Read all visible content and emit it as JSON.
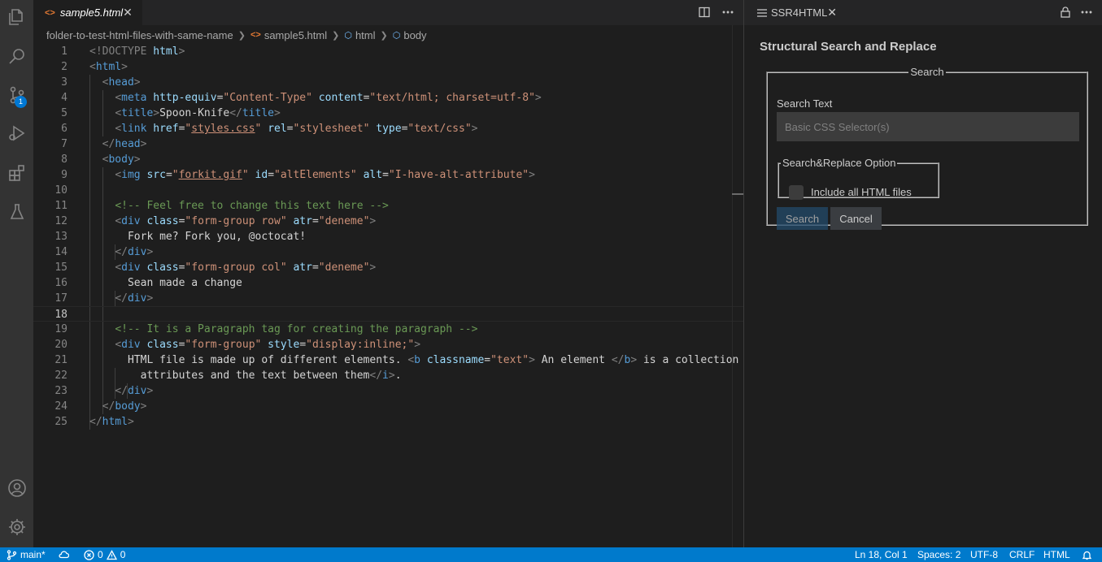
{
  "editor": {
    "tab": {
      "icon": "html-file-icon",
      "label": "sample5.html",
      "close": "✕"
    },
    "breadcrumb": {
      "folder": "folder-to-test-html-files-with-same-name",
      "file": "sample5.html",
      "element1": "html",
      "element2": "body"
    },
    "current_line": 18,
    "lines": [
      {
        "n": "1"
      },
      {
        "n": "2"
      },
      {
        "n": "3"
      },
      {
        "n": "4"
      },
      {
        "n": "5"
      },
      {
        "n": "6"
      },
      {
        "n": "7"
      },
      {
        "n": "8"
      },
      {
        "n": "9"
      },
      {
        "n": "10"
      },
      {
        "n": "11"
      },
      {
        "n": "12"
      },
      {
        "n": "13"
      },
      {
        "n": "14"
      },
      {
        "n": "15"
      },
      {
        "n": "16"
      },
      {
        "n": "17"
      },
      {
        "n": "18"
      },
      {
        "n": "19"
      },
      {
        "n": "20"
      },
      {
        "n": "21"
      },
      {
        "n": "22"
      },
      {
        "n": "23"
      },
      {
        "n": "24"
      },
      {
        "n": "25"
      }
    ],
    "code": {
      "l1a": "<!DOCTYPE ",
      "l1b": "html",
      "l1c": ">",
      "l2": "html",
      "l3": "head",
      "l4_tag": "meta",
      "l4_attr1": "http-equiv",
      "l4_val1": "\"Content-Type\"",
      "l4_attr2": "content",
      "l4_val2": "\"text/html; charset=utf-8\"",
      "l5_tag": "title",
      "l5_text": "Spoon-Knife",
      "l6_tag": "link",
      "l6_attr1": "href",
      "l6_val1": "styles.css",
      "l6_attr2": "rel",
      "l6_val2": "\"stylesheet\"",
      "l6_attr3": "type",
      "l6_val3": "\"text/css\"",
      "l7": "head",
      "l8": "body",
      "l9_tag": "img",
      "l9_attr1": "src",
      "l9_val1": "forkit.gif",
      "l9_attr2": "id",
      "l9_val2": "\"altElements\"",
      "l9_attr3": "alt",
      "l9_val3": "\"I-have-alt-attribute\"",
      "l11": "<!-- Feel free to change this text here -->",
      "l12_tag": "div",
      "l12_attr1": "class",
      "l12_val1": "\"form-group row\"",
      "l12_attr2": "atr",
      "l12_val2": "\"deneme\"",
      "l13": "Fork me? Fork you, @octocat!",
      "l14": "div",
      "l15_tag": "div",
      "l15_attr1": "class",
      "l15_val1": "\"form-group col\"",
      "l15_attr2": "atr",
      "l15_val2": "\"deneme\"",
      "l16": "Sean made a change",
      "l17": "div",
      "l19": "<!-- It is a Paragraph tag for creating the paragraph -->",
      "l20_tag": "div",
      "l20_attr1": "class",
      "l20_val1": "\"form-group\"",
      "l20_attr2": "style",
      "l20_val2": "\"display:inline;\"",
      "l21_text1": "HTML file is made up of different elements. ",
      "l21_tag": "b",
      "l21_attr": "classname",
      "l21_val": "\"text\"",
      "l21_text2": " An element ",
      "l21_tag2": "b",
      "l21_text3": " is a collection of",
      "l22_text": "attributes and the text between them",
      "l22_tag": "i",
      "l22_end": ".",
      "l23": "div",
      "l24": "body",
      "l25": "html"
    }
  },
  "panel": {
    "tab_label": "SSR4HTML",
    "title": "Structural Search and Replace",
    "search_legend": "Search",
    "search_text_label": "Search Text",
    "search_placeholder": "Basic CSS Selector(s)",
    "option_legend": "Search&Replace Option",
    "include_all_label": "Include all HTML files",
    "search_button": "Search",
    "cancel_button": "Cancel"
  },
  "status": {
    "branch": "main*",
    "errors": "0",
    "warnings": "0",
    "position": "Ln 18, Col 1",
    "spaces": "Spaces: 2",
    "encoding": "UTF-8",
    "eol": "CRLF",
    "language": "HTML"
  },
  "activity": {
    "scm_badge": "1"
  },
  "colors": {
    "accent": "#007acc",
    "tag": "#569cd6",
    "attr": "#9cdcfe",
    "string": "#ce9178",
    "comment": "#6a9955"
  }
}
